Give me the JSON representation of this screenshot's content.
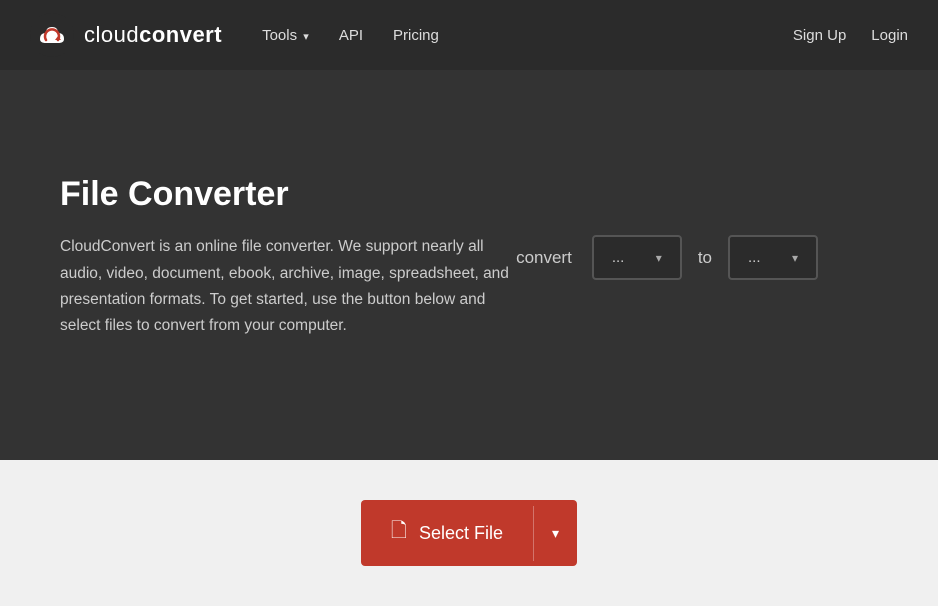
{
  "nav": {
    "brand": "cloudconvert",
    "brand_bold": "convert",
    "tools_label": "Tools",
    "api_label": "API",
    "pricing_label": "Pricing",
    "signup_label": "Sign Up",
    "login_label": "Login"
  },
  "hero": {
    "title": "File Converter",
    "description": "CloudConvert is an online file converter. We support nearly all audio, video, document, ebook, archive, image, spreadsheet, and presentation formats. To get started, use the button below and select files to convert from your computer."
  },
  "converter": {
    "convert_label": "convert",
    "from_placeholder": "...",
    "to_label": "to",
    "to_placeholder": "..."
  },
  "actions": {
    "select_file_label": "Select File"
  },
  "icons": {
    "chevron_down": "▾",
    "file_icon": "📄"
  }
}
